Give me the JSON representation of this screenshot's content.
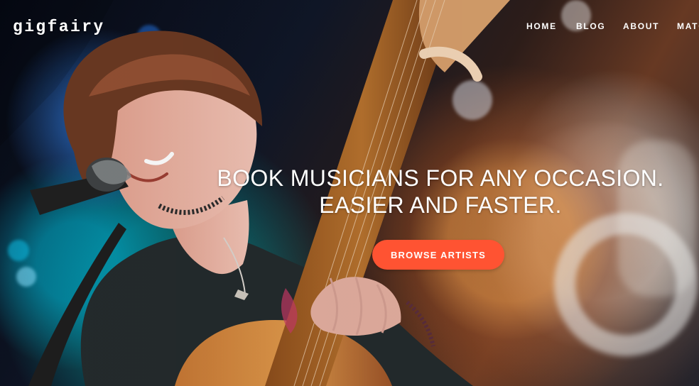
{
  "brand": {
    "logo_text": "gigfairy"
  },
  "nav": {
    "items": [
      {
        "label": "HOME"
      },
      {
        "label": "BLOG"
      },
      {
        "label": "ABOUT"
      },
      {
        "label": "MATC"
      }
    ]
  },
  "hero": {
    "headline_line_1": "BOOK MUSICIANS FOR ANY OCCASION.",
    "headline_line_2": "EASIER AND FASTER.",
    "button_label": "BROWSE ARTISTS"
  },
  "colors": {
    "button": "#ff5332",
    "text": "#ffffff"
  }
}
